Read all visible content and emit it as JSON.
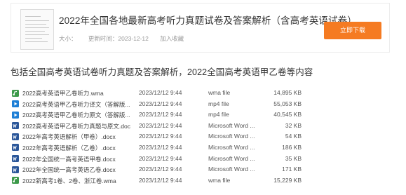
{
  "header": {
    "title": "2022年全国各地最新高考听力真题试卷及答案解析（含高考英语试卷）",
    "size_label": "大小：",
    "updated_label": "更新时间：",
    "updated_value": "2023-12-12",
    "favorite_label": "加入收藏",
    "download_label": "立即下载"
  },
  "description": "包括全国高考英语试卷听力真题及答案解析，2022全国高考英语甲乙卷等内容",
  "files": [
    {
      "name": "2022高考英语甲乙卷听力.wma",
      "date": "2023/12/12 9:44",
      "type": "wma file",
      "size": "14,895 KB",
      "icon": "audio-file-icon"
    },
    {
      "name": "2022高考英语甲乙卷听力译文（答解版...",
      "date": "2023/12/12 9:44",
      "type": "mp4 file",
      "size": "55,053 KB",
      "icon": "video-file-icon"
    },
    {
      "name": "2022高考英语甲乙卷听力原文（答解版...",
      "date": "2023/12/12 9:44",
      "type": "mp4 file",
      "size": "40,545 KB",
      "icon": "video-file-icon"
    },
    {
      "name": "2022高考英语甲乙卷听力真题与原文.doc",
      "date": "2023/12/12 9:44",
      "type": "Microsoft Word ...",
      "size": "32 KB",
      "icon": "word-file-icon"
    },
    {
      "name": "2022年高考英语解析（甲卷）.docx",
      "date": "2023/12/12 9:44",
      "type": "Microsoft Word ...",
      "size": "54 KB",
      "icon": "word-file-icon"
    },
    {
      "name": "2022年高考英语解析（乙卷）.docx",
      "date": "2023/12/12 9:44",
      "type": "Microsoft Word ...",
      "size": "186 KB",
      "icon": "word-file-icon"
    },
    {
      "name": "2022年全国统一高考英语甲卷.docx",
      "date": "2023/12/12 9:44",
      "type": "Microsoft Word ...",
      "size": "35 KB",
      "icon": "word-file-icon"
    },
    {
      "name": "2022年全国统一高考英语乙卷.docx",
      "date": "2023/12/12 9:44",
      "type": "Microsoft Word ...",
      "size": "171 KB",
      "icon": "word-file-icon"
    },
    {
      "name": "2022新高考1卷、2卷、浙江卷.wma",
      "date": "2023/12/12 9:44",
      "type": "wma file",
      "size": "15,229 KB",
      "icon": "audio-file-icon"
    }
  ]
}
